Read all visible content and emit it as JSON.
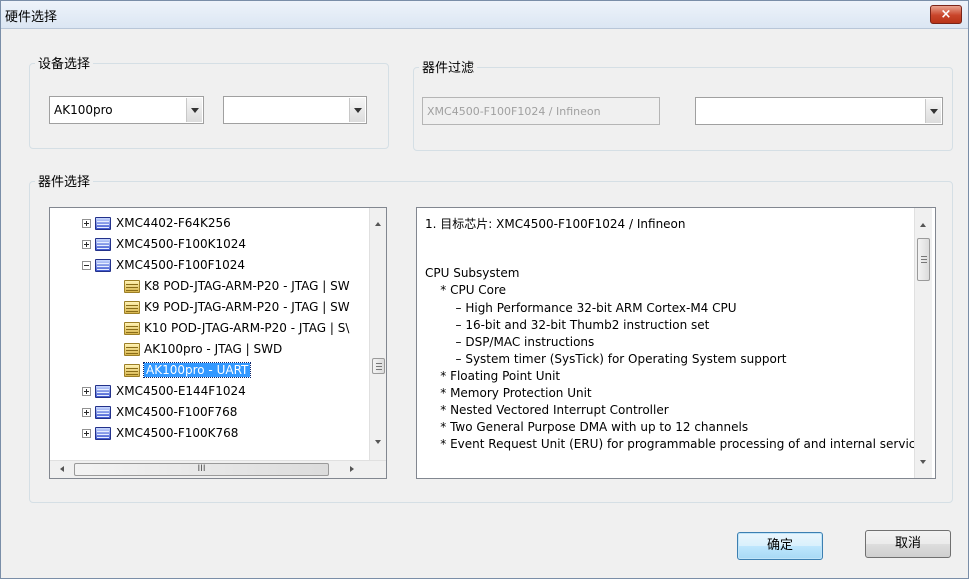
{
  "window": {
    "title": "硬件选择",
    "close_label": "×"
  },
  "device_group": {
    "label": "设备选择",
    "device_combo_value": "AK100pro",
    "secondary_combo_value": ""
  },
  "filter_group": {
    "label": "器件过滤",
    "filter_text": "XMC4500-F100F1024 / Infineon",
    "filter_combo_value": ""
  },
  "selection_group": {
    "label": "器件选择"
  },
  "tree": [
    {
      "label": "XMC4402-F64K256",
      "type": "chip",
      "expander": "plus",
      "level": 0
    },
    {
      "label": "XMC4500-F100K1024",
      "type": "chip",
      "expander": "plus",
      "level": 0
    },
    {
      "label": "XMC4500-F100F1024",
      "type": "chip",
      "expander": "minus",
      "level": 0
    },
    {
      "label": "K8  POD-JTAG-ARM-P20  - JTAG | SW",
      "type": "folder",
      "expander": "none",
      "level": 1
    },
    {
      "label": "K9  POD-JTAG-ARM-P20  - JTAG | SW",
      "type": "folder",
      "expander": "none",
      "level": 1
    },
    {
      "label": "K10  POD-JTAG-ARM-P20  - JTAG | S\\",
      "type": "folder",
      "expander": "none",
      "level": 1
    },
    {
      "label": "AK100pro    - JTAG | SWD",
      "type": "folder",
      "expander": "none",
      "level": 1
    },
    {
      "label": "AK100pro    - UART",
      "type": "folder",
      "expander": "none",
      "level": 1,
      "selected": true
    },
    {
      "label": "XMC4500-E144F1024",
      "type": "chip",
      "expander": "plus",
      "level": 0
    },
    {
      "label": "XMC4500-F100F768",
      "type": "chip",
      "expander": "plus",
      "level": 0
    },
    {
      "label": "XMC4500-F100K768",
      "type": "chip",
      "expander": "plus",
      "level": 0
    }
  ],
  "tree_hscroll_thumb_label": "III",
  "info_lines": [
    "1. 目标芯片: XMC4500-F100F1024 / Infineon",
    "",
    "",
    "CPU Subsystem",
    "    * CPU Core",
    "        – High Performance 32-bit ARM Cortex-M4 CPU",
    "        – 16-bit and 32-bit Thumb2 instruction set",
    "        – DSP/MAC instructions",
    "        – System timer (SysTick) for Operating System support",
    "    * Floating Point Unit",
    "    * Memory Protection Unit",
    "    * Nested Vectored Interrupt Controller",
    "    * Two General Purpose DMA with up to 12 channels",
    "    * Event Request Unit (ERU) for programmable processing of and internal service"
  ],
  "buttons": {
    "ok": "确定",
    "cancel": "取消"
  },
  "colors": {
    "selection": "#3399ff",
    "title_close": "#c9442a"
  }
}
